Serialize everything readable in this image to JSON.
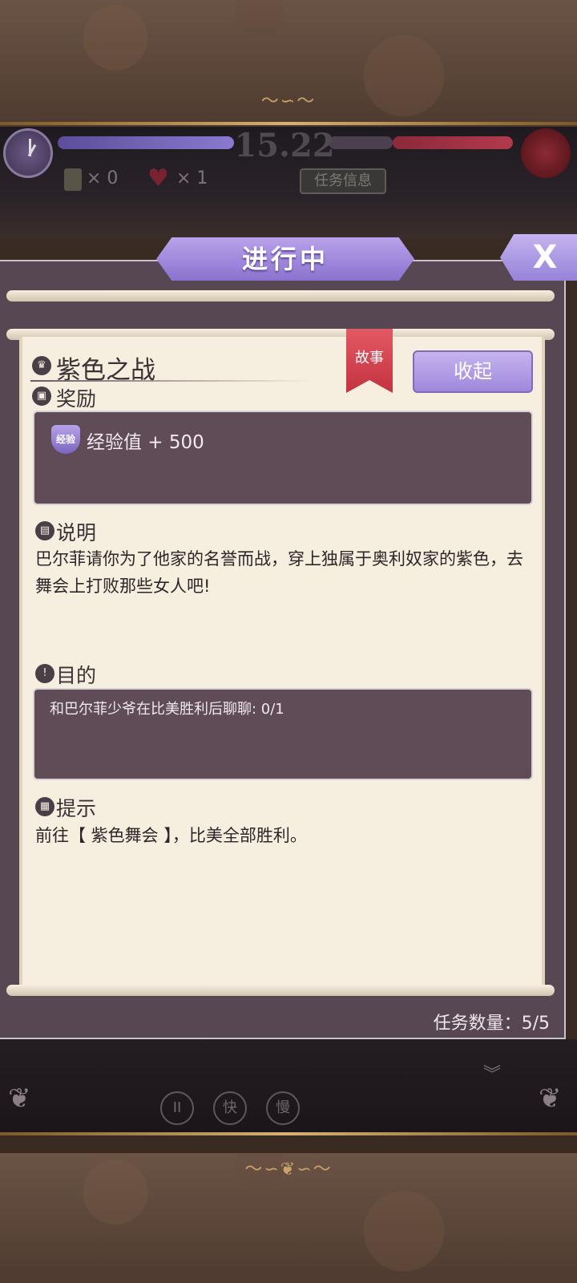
{
  "hud": {
    "timer": "15.22",
    "scroll_count": "× 0",
    "heart_count": "× 1",
    "task_info_label": "任务信息"
  },
  "panel": {
    "status": "进行中",
    "close_label": "X",
    "quest_title": "紫色之战",
    "tag": "故事",
    "collapse_label": "收起",
    "reward_label": "奖励",
    "reward_badge": "经验",
    "reward_text": "经验值 + 500",
    "description_label": "说明",
    "description_text": "巴尔菲请你为了他家的名誉而战，穿上独属于奥利奴家的紫色，去舞会上打败那些女人吧!",
    "objective_label": "目的",
    "objective_text": "和巴尔菲少爷在比美胜利后聊聊: 0/1",
    "hint_label": "提示",
    "hint_text": "前往【 紫色舞会 】，比美全部胜利。",
    "task_count": "任务数量：5/5"
  },
  "controls": {
    "pause": "II",
    "fast": "快",
    "slow": "慢"
  },
  "colors": {
    "accent_purple": "#9e88dc",
    "ribbon_red": "#c4323f",
    "parchment": "#f6efdf",
    "panel_bg": "#574752"
  }
}
